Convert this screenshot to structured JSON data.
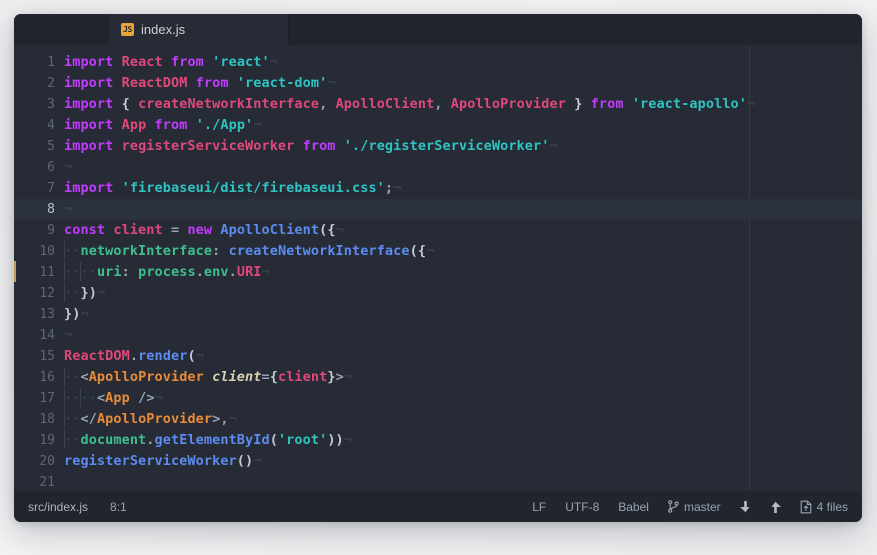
{
  "window": {
    "title": "index.js"
  },
  "tabbar": {
    "tabs": [
      {
        "label": "index.js",
        "icon": "js-file-icon",
        "icon_text": "JS",
        "active": true
      }
    ]
  },
  "editor": {
    "language": "JavaScript",
    "lines": [
      {
        "num": "1",
        "marked": false,
        "active": false
      },
      {
        "num": "2",
        "marked": false,
        "active": false
      },
      {
        "num": "3",
        "marked": false,
        "active": false
      },
      {
        "num": "4",
        "marked": false,
        "active": false
      },
      {
        "num": "5",
        "marked": false,
        "active": false
      },
      {
        "num": "6",
        "marked": false,
        "active": false
      },
      {
        "num": "7",
        "marked": false,
        "active": false
      },
      {
        "num": "8",
        "marked": false,
        "active": true
      },
      {
        "num": "9",
        "marked": false,
        "active": false
      },
      {
        "num": "10",
        "marked": false,
        "active": false
      },
      {
        "num": "11",
        "marked": true,
        "active": false
      },
      {
        "num": "12",
        "marked": false,
        "active": false
      },
      {
        "num": "13",
        "marked": false,
        "active": false
      },
      {
        "num": "14",
        "marked": false,
        "active": false
      },
      {
        "num": "15",
        "marked": false,
        "active": false
      },
      {
        "num": "16",
        "marked": false,
        "active": false
      },
      {
        "num": "17",
        "marked": false,
        "active": false
      },
      {
        "num": "18",
        "marked": false,
        "active": false
      },
      {
        "num": "19",
        "marked": false,
        "active": false
      },
      {
        "num": "20",
        "marked": false,
        "active": false
      },
      {
        "num": "21",
        "marked": false,
        "active": false
      }
    ],
    "source_text": [
      "import React from 'react'",
      "import ReactDOM from 'react-dom'",
      "import { createNetworkInterface, ApolloClient, ApolloProvider } from 'react-apollo'",
      "import App from './App'",
      "import registerServiceWorker from './registerServiceWorker'",
      "",
      "import 'firebaseui/dist/firebaseui.css';",
      "",
      "const client = new ApolloClient({",
      "  networkInterface: createNetworkInterface({",
      "    uri: process.env.URI",
      "  })",
      "})",
      "",
      "ReactDOM.render(",
      "  <ApolloProvider client={client}>",
      "    <App />",
      "  </ApolloProvider>,",
      "  document.getElementById('root'))",
      "registerServiceWorker()",
      ""
    ]
  },
  "statusbar": {
    "file_path": "src/index.js",
    "cursor_position": "8:1",
    "line_ending": "LF",
    "encoding": "UTF-8",
    "grammar": "Babel",
    "branch": "master",
    "branch_icon": "git-branch-icon",
    "pull_icon": "arrow-down-icon",
    "push_icon": "arrow-up-icon",
    "files_icon": "files-changed-icon",
    "files_changed": "4 files"
  },
  "theme": {
    "window_bg": "#262b35",
    "chrome_bg": "#21252e",
    "active_line_bg": "#2c323d",
    "gutter_fg": "#5d6675",
    "keyword": "#c23cff",
    "string": "#2ec4c4",
    "identifier": "#e0487b",
    "function": "#5c8cf0",
    "property": "#3fbf8f",
    "jsx_tag": "#e88c3a",
    "attribute": "#d8d2b0",
    "plain": "#c5ccd6",
    "marker": "#c0a050",
    "js_icon": "#e8a33d"
  }
}
